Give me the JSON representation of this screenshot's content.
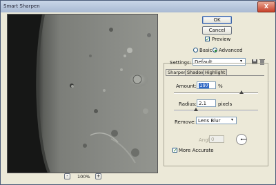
{
  "window": {
    "title": "Smart Sharpen",
    "close_glyph": "X"
  },
  "buttons": {
    "ok": "OK",
    "cancel": "Cancel"
  },
  "preview_checkbox": {
    "label": "Preview",
    "checked": true
  },
  "mode": {
    "basic": "Basic",
    "advanced": "Advanced",
    "selected": "Advanced"
  },
  "settings": {
    "label": "Settings:",
    "value": "Default"
  },
  "tabs": [
    {
      "label": "Sharpen",
      "active": true
    },
    {
      "label": "Shadow",
      "active": false
    },
    {
      "label": "Highlight",
      "active": false
    }
  ],
  "amount": {
    "label": "Amount:",
    "value": "197",
    "unit": "%",
    "fraction": 0.39
  },
  "radius": {
    "label": "Radius:",
    "value": "2.1",
    "unit": "pixels",
    "fraction": 0.03
  },
  "remove": {
    "label": "Remove:",
    "value": "Lens Blur"
  },
  "angle": {
    "label": "Angle:",
    "value": "0"
  },
  "more_accurate": {
    "label": "More Accurate",
    "checked": true
  },
  "zoom": {
    "value": "100%",
    "minus": "-",
    "plus": "+"
  },
  "icons": {
    "save": "floppy-disk-icon",
    "delete": "trash-icon",
    "dropdown": "chevron-down-icon"
  }
}
